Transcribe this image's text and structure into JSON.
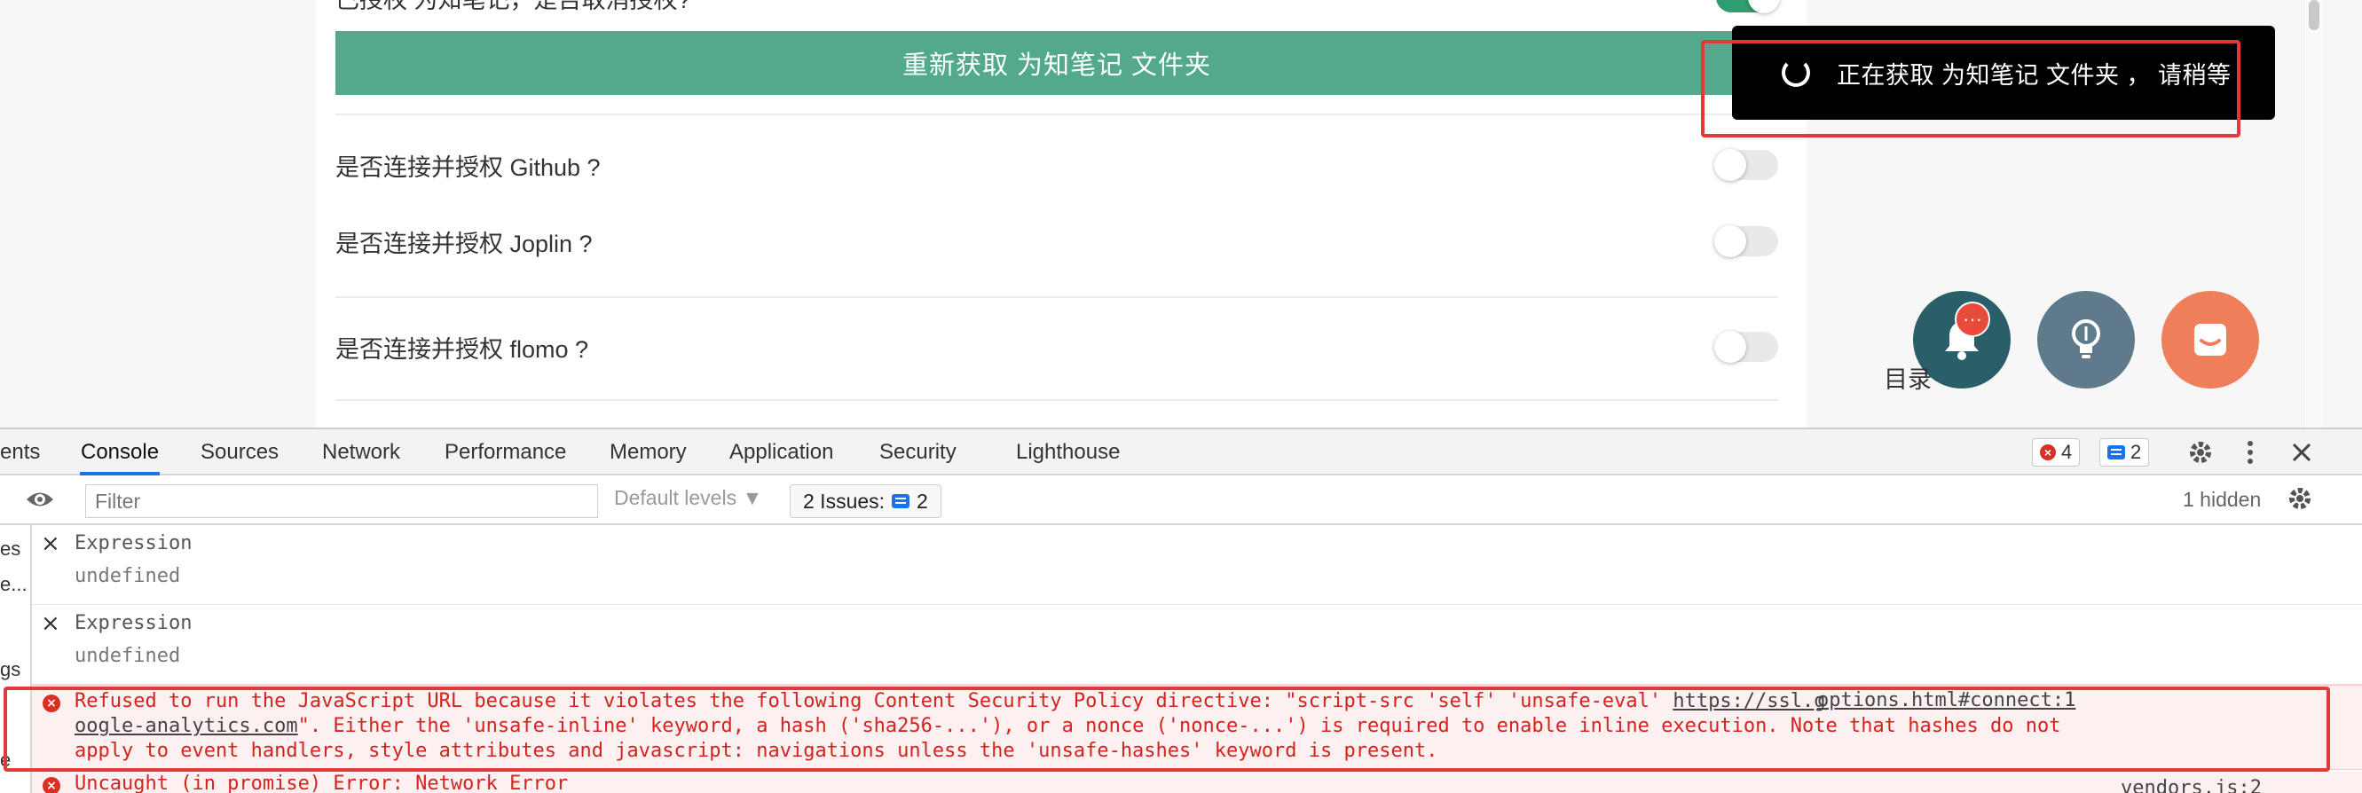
{
  "settings": {
    "partial_row_label": "已授权 为知笔记，是否取消授权?",
    "refetch_button_label": "重新获取 为知笔记 文件夹",
    "rows": [
      {
        "label": "是否连接并授权 Github ?",
        "enabled": false
      },
      {
        "label": "是否连接并授权 Joplin ?",
        "enabled": false
      },
      {
        "label": "是否连接并授权 flomo ?",
        "enabled": false
      }
    ]
  },
  "toast": {
    "text": "正在获取 为知笔记 文件夹 ， 请稍等"
  },
  "fabs": {
    "bell_badge": "···",
    "toc_label": "目录"
  },
  "devtools": {
    "tabs": [
      "ents",
      "Console",
      "Sources",
      "Network",
      "Performance",
      "Memory",
      "Application",
      "Security",
      "Lighthouse"
    ],
    "active_tab": "Console",
    "error_count": "4",
    "message_count": "2",
    "filter_placeholder": "Filter",
    "levels_label": "Default levels ▼",
    "issues_label": "2 Issues:",
    "issues_count": "2",
    "hidden_label": "1 hidden",
    "sidebar_items": [
      "es",
      "e...",
      "gs",
      "e"
    ]
  },
  "console": {
    "entries": [
      {
        "label": "Expression",
        "value": "undefined"
      },
      {
        "label": "Expression",
        "value": "undefined"
      }
    ],
    "error": {
      "line1": "Refused to run the JavaScript URL because it violates the following Content Security Policy directive: \"script-src 'self' 'unsafe-eval' ",
      "line1_link": "https://ssl.g",
      "source_link": "options.html#connect:1",
      "line2_link": "oogle-analytics.com",
      "line2": "\". Either the 'unsafe-inline' keyword, a hash ('sha256-...'), or a nonce ('nonce-...') is required to enable inline execution. Note that hashes do not",
      "line3": "apply to event handlers, style attributes and javascript: navigations unless the 'unsafe-hashes' keyword is present."
    },
    "next_error": {
      "text": "Uncaught (in promise) Error: Network Error",
      "source_link": "vendors.js:2"
    }
  },
  "colors": {
    "accent_green": "#52a98c",
    "error_red": "#d3231f",
    "highlight_red": "#e03a3a",
    "fab_bell": "#2a5f69",
    "fab_bulb": "#5f7b8b",
    "fab_chat": "#ef7f5b"
  },
  "icons": [
    "spinner-icon",
    "bell-icon",
    "bulb-icon",
    "chat-icon",
    "eye-icon",
    "gear-icon",
    "kebab-icon",
    "close-icon",
    "error-icon",
    "message-icon"
  ]
}
